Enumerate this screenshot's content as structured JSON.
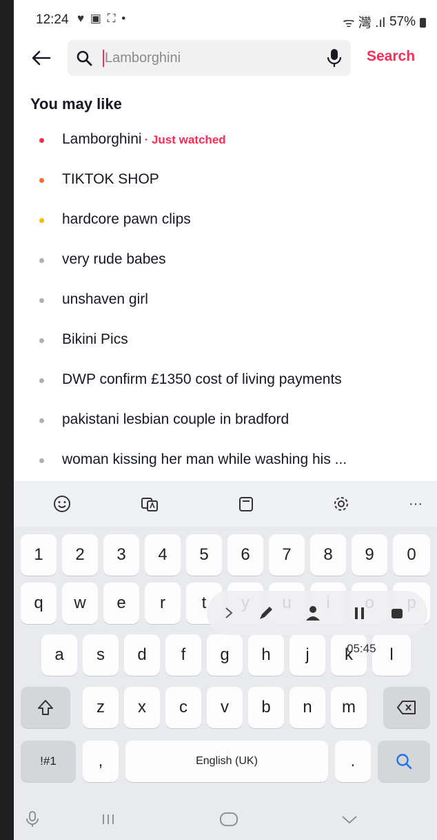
{
  "status": {
    "time": "12:24",
    "notifications": "♥ ▣ ⛶ •",
    "signal": "ᯤ 灣 .ıl",
    "battery": "57%"
  },
  "search": {
    "placeholder": "Lamborghini",
    "value": "",
    "button": "Search"
  },
  "section_title": "You may like",
  "suggestions": [
    {
      "text": "Lamborghini",
      "badge": "· Just watched",
      "dot_color": "#fe2c55"
    },
    {
      "text": "TIKTOK SHOP",
      "dot_color": "#ff6a2b"
    },
    {
      "text": "hardcore pawn clips",
      "dot_color": "#ffb800"
    },
    {
      "text": "very rude babes",
      "dot_color": "#b0b0b4"
    },
    {
      "text": "unshaven girl",
      "dot_color": "#b0b0b4"
    },
    {
      "text": "Bikini Pics",
      "dot_color": "#b0b0b4"
    },
    {
      "text": "DWP confirm £1350 cost of living payments",
      "dot_color": "#b0b0b4"
    },
    {
      "text": "pakistani lesbian couple in bradford",
      "dot_color": "#b0b0b4"
    },
    {
      "text": "woman kissing her man while washing his ...",
      "dot_color": "#b0b0b4"
    }
  ],
  "keyboard": {
    "toolbar": [
      "emoji-icon",
      "translate-icon",
      "clipboard-icon",
      "settings-icon",
      "more-icon"
    ],
    "more": "···",
    "numbers": [
      "1",
      "2",
      "3",
      "4",
      "5",
      "6",
      "7",
      "8",
      "9",
      "0"
    ],
    "row1": [
      "q",
      "w",
      "e",
      "r",
      "t",
      "y",
      "u",
      "i",
      "o",
      "p"
    ],
    "row2": [
      "a",
      "s",
      "d",
      "f",
      "g",
      "h",
      "j",
      "k",
      "l"
    ],
    "row3": [
      "z",
      "x",
      "c",
      "v",
      "b",
      "n",
      "m"
    ],
    "symbols": "!#1",
    "comma": ",",
    "space": "English (UK)",
    "period": "."
  },
  "recorder": {
    "time": "05:45",
    "icons": [
      "chevron-right-icon",
      "pen-icon",
      "person-icon",
      "pause-icon",
      "stop-icon"
    ]
  },
  "navbar": [
    "mic-icon",
    "recents-icon",
    "home-icon",
    "hide-keyboard-icon"
  ]
}
